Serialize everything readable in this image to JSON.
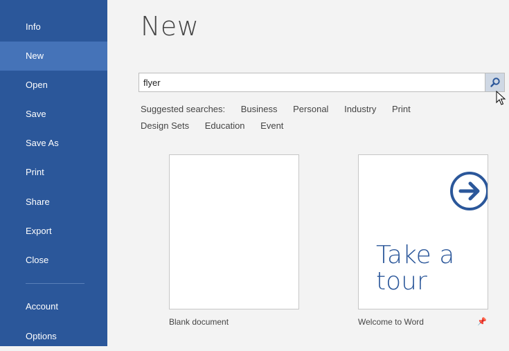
{
  "sidebar": {
    "items": [
      {
        "label": "Info"
      },
      {
        "label": "New"
      },
      {
        "label": "Open"
      },
      {
        "label": "Save"
      },
      {
        "label": "Save As"
      },
      {
        "label": "Print"
      },
      {
        "label": "Share"
      },
      {
        "label": "Export"
      },
      {
        "label": "Close"
      },
      {
        "label": "Account"
      },
      {
        "label": "Options"
      }
    ],
    "selected": "New",
    "color": "#2b579a",
    "selected_color": "#4573b8"
  },
  "main": {
    "title": "New",
    "search": {
      "value": "flyer",
      "icon": "search-icon"
    },
    "suggested": {
      "label": "Suggested searches:",
      "items": [
        "Business",
        "Personal",
        "Industry",
        "Print",
        "Design Sets",
        "Education",
        "Event"
      ]
    },
    "templates": [
      {
        "caption": "Blank document"
      },
      {
        "caption": "Welcome to Word",
        "thumb_text_line1": "Take a",
        "thumb_text_line2": "tour",
        "icon": "arrow-circle-icon"
      }
    ],
    "pin_icon": "pin-icon"
  }
}
